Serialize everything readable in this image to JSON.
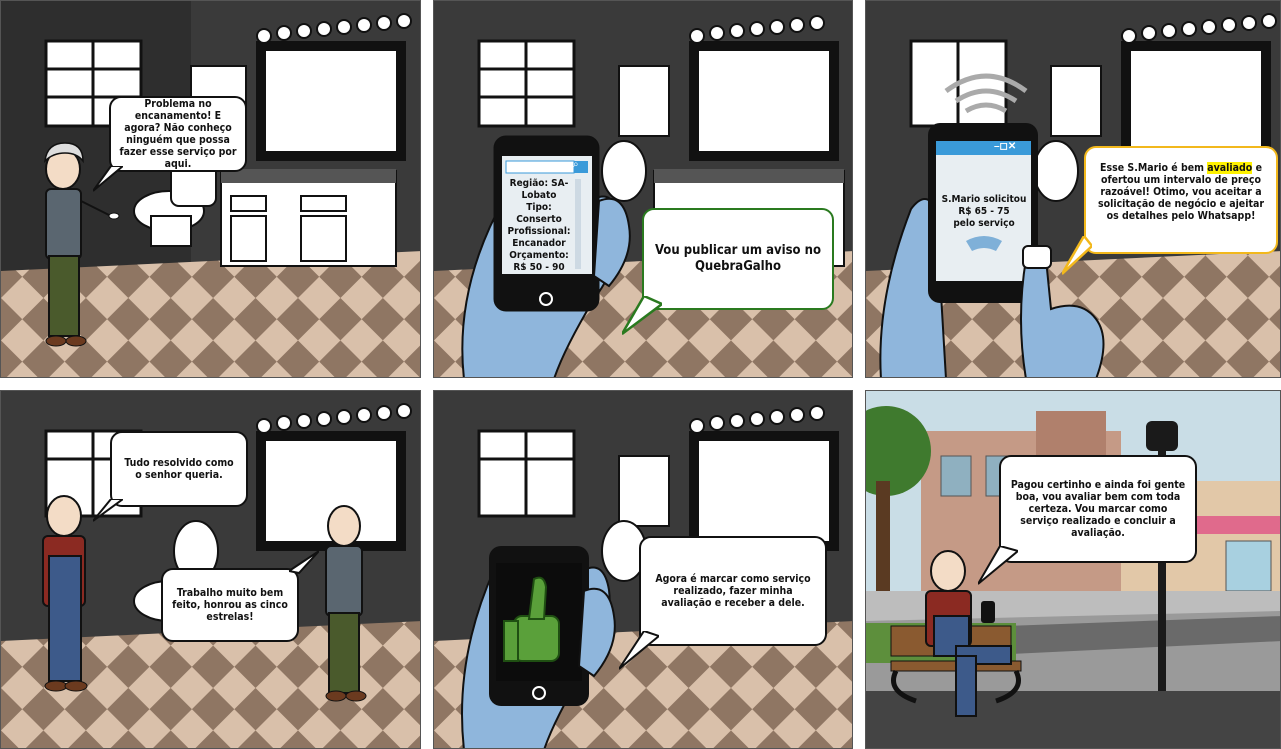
{
  "colors": {
    "wall": "#3a3a3a",
    "floor_light": "#d9c0aa",
    "floor_dark": "#8f7663",
    "phone_screen": "#e8eef2",
    "accent_blue": "#3a9ad9",
    "bubble_green": "#2a7a1f",
    "bubble_yellow": "#f2b81c",
    "highlight": "#fff200"
  },
  "panel1": {
    "bubble": "Problema no encanamento! E agora? Não conheço ninguém que possa fazer esse serviço por aqui."
  },
  "panel2": {
    "phone_lines": [
      "Região: SA-",
      "Lobato",
      "Tipo:",
      "Conserto",
      "Profissional:",
      "Encanador",
      "Orçamento:",
      "R$ 50 - 90"
    ],
    "bubble": "Vou publicar um aviso no QuebraGalho"
  },
  "panel3": {
    "phone_name": "S.Mario",
    "phone_rest": " solicitou",
    "phone_price": "R$ 65 - 75",
    "phone_for": "pelo serviço",
    "window_controls": "–◻✕",
    "bubble_pre": "Esse ",
    "bubble_name": "S.Mario",
    "bubble_mid": " é bem ",
    "bubble_hl": "avaliado",
    "bubble_post": " e ofertou um intervalo de preço razoável! Otimo, vou aceitar a solicitação de negócio e ajeitar os detalhes pelo Whatsapp!"
  },
  "panel4": {
    "bubble_top": "Tudo resolvido como o senhor queria.",
    "bubble_bottom": "Trabalho muito bem feito, honrou as cinco estrelas!"
  },
  "panel5": {
    "bubble": "Agora é marcar como serviço realizado, fazer minha avaliação e receber a dele."
  },
  "panel6": {
    "bubble": "Pagou certinho e ainda foi gente boa, vou avaliar bem com toda certeza.  Vou marcar como serviço realizado e concluir a avaliação."
  }
}
